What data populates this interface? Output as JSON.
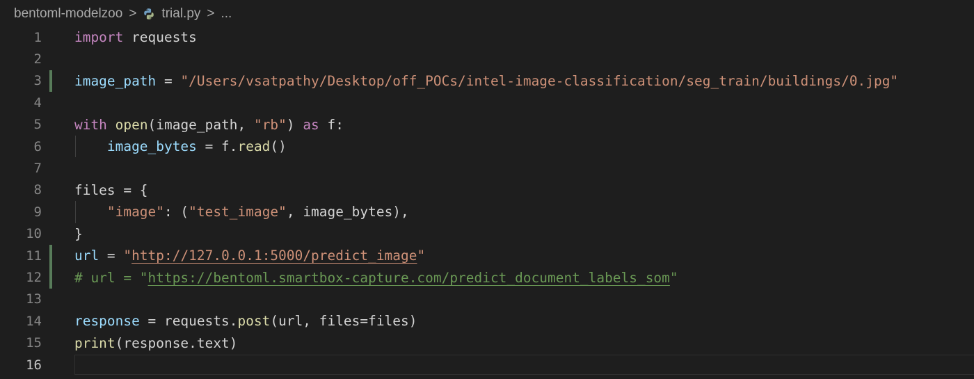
{
  "breadcrumb": {
    "folder": "bentoml-modelzoo",
    "separator": ">",
    "file": "trial.py",
    "more": "..."
  },
  "icons": {
    "file_icon": "python-icon"
  },
  "colors": {
    "background": "#1e1e1e",
    "change_bar": "#587c5a"
  },
  "editor": {
    "current_line": 16,
    "line_numbers": [
      "1",
      "2",
      "3",
      "4",
      "5",
      "6",
      "7",
      "8",
      "9",
      "10",
      "11",
      "12",
      "13",
      "14",
      "15",
      "16"
    ],
    "code": {
      "l1_import": "import",
      "l1_module": " requests",
      "l3_var": "image_path",
      "l3_eq": " = ",
      "l3_str": "\"/Users/vsatpathy/Desktop/off_POCs/intel-image-classification/seg_train/buildings/0.jpg\"",
      "l5_with": "with",
      "l5_sp1": " ",
      "l5_open": "open",
      "l5_args": "(image_path, ",
      "l5_rb": "\"rb\"",
      "l5_close": ") ",
      "l5_as": "as",
      "l5_f": " f:",
      "l6_indent": "    ",
      "l6_var": "image_bytes",
      "l6_rest": " = f.",
      "l6_read": "read",
      "l6_paren": "()",
      "l8_text": "files = {",
      "l9_indent": "    ",
      "l9_key": "\"image\"",
      "l9_mid": ": (",
      "l9_val": "\"test_image\"",
      "l9_end": ", image_bytes),",
      "l10_text": "}",
      "l11_var": "url",
      "l11_eq": " = ",
      "l11_q1": "\"",
      "l11_link": "http://127.0.0.1:5000/predict_image",
      "l11_q2": "\"",
      "l12_prefix": "# url = \"",
      "l12_link": "https://bentoml.smartbox-capture.com/predict_document_labels_som",
      "l12_q": "\"",
      "l14_var": "response",
      "l14_mid": " = requests.",
      "l14_post": "post",
      "l14_end": "(url, files=files)",
      "l15_print": "print",
      "l15_end": "(response.text)"
    }
  }
}
